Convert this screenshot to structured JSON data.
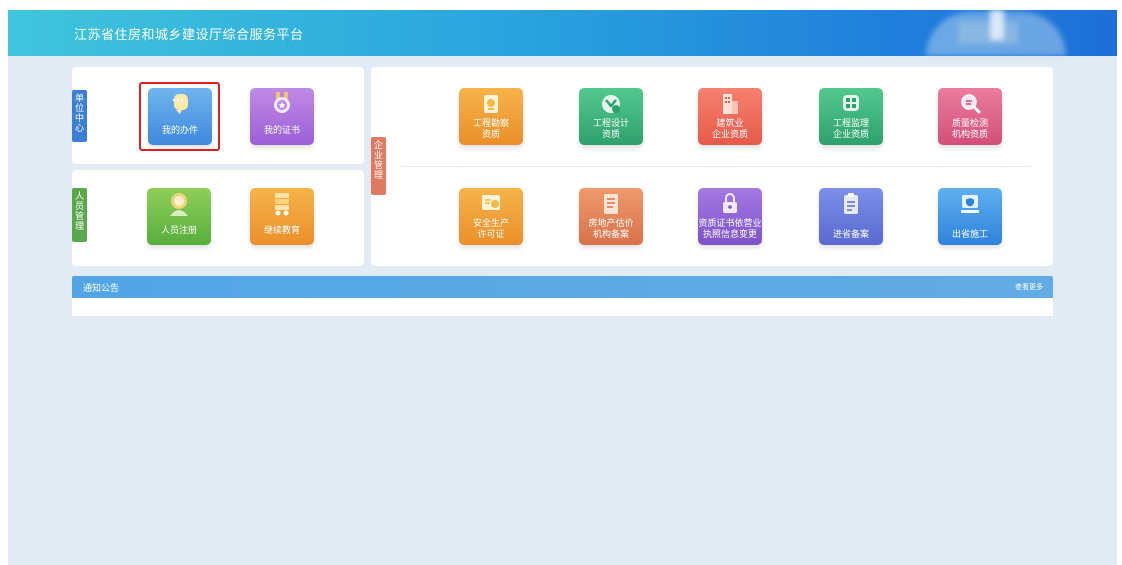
{
  "header": {
    "title": "江苏省住房和城乡建设厅综合服务平台"
  },
  "sections": {
    "unit_center": "单\n位\n中\n心",
    "personnel": "人\n员\n管\n理",
    "enterprise": "企\n业\n管\n理"
  },
  "unit_tiles": [
    {
      "label": "我的办件",
      "icon": "chat-bubble-icon",
      "color": "#4a90e2"
    },
    {
      "label": "我的证书",
      "icon": "medal-icon",
      "color": "#a56ddb"
    }
  ],
  "personnel_tiles": [
    {
      "label": "人员注册",
      "icon": "person-icon",
      "color": "#6cba48"
    },
    {
      "label": "继续教育",
      "icon": "book-stack-icon",
      "color": "#f0a23c"
    }
  ],
  "enterprise_tiles": [
    {
      "label": "工程勘察\n资质",
      "icon": "survey-icon",
      "color": "#f5a623"
    },
    {
      "label": "工程设计\n资质",
      "icon": "design-icon",
      "color": "#3cb878"
    },
    {
      "label": "建筑业\n企业资质",
      "icon": "building-icon",
      "color": "#f07057"
    },
    {
      "label": "工程监理\n企业资质",
      "icon": "supervision-icon",
      "color": "#3cb878"
    },
    {
      "label": "质量检测\n机构资质",
      "icon": "magnifier-icon",
      "color": "#e15f86"
    },
    {
      "label": "安全生产\n许可证",
      "icon": "certificate-icon",
      "color": "#f0a23c"
    },
    {
      "label": "房地产估价\n机构备案",
      "icon": "document-icon",
      "color": "#e0784f"
    },
    {
      "label": "资质证书依营业\n执照信息变更",
      "icon": "lock-icon",
      "color": "#8a5ad1"
    },
    {
      "label": "进省备案",
      "icon": "clipboard-icon",
      "color": "#6275dc"
    },
    {
      "label": "出省施工",
      "icon": "shield-board-icon",
      "color": "#3a8fe0"
    }
  ],
  "notice": {
    "title": "通知公告",
    "more": "查看更多"
  }
}
